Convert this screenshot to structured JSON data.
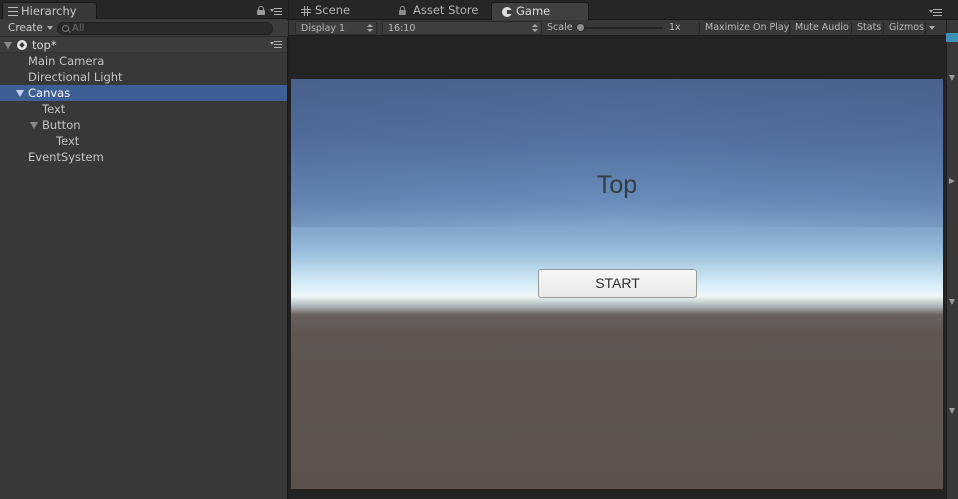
{
  "hierarchy": {
    "tab_label": "Hierarchy",
    "create_label": "Create",
    "search_placeholder": "All",
    "scene_name": "top*",
    "items": [
      {
        "label": "Main Camera"
      },
      {
        "label": "Directional Light"
      },
      {
        "label": "Canvas"
      },
      {
        "label": "Text"
      },
      {
        "label": "Button"
      },
      {
        "label": "Text"
      },
      {
        "label": "EventSystem"
      }
    ],
    "selected_color": "#3e5f96"
  },
  "game_panel": {
    "tabs": [
      {
        "label": "Scene",
        "icon": "grid-icon"
      },
      {
        "label": "Asset Store",
        "icon": "lock-icon"
      },
      {
        "label": "Game",
        "icon": "pacman-icon"
      }
    ],
    "active_tab": "Game",
    "toolbar": {
      "display": "Display 1",
      "aspect": "16:10",
      "scale_label": "Scale",
      "scale_value": "1x",
      "maximize_on_play": "Maximize On Play",
      "mute_audio": "Mute Audio",
      "stats": "Stats",
      "gizmos": "Gizmos"
    },
    "view": {
      "title_text": "Top",
      "button_text": "START"
    }
  }
}
